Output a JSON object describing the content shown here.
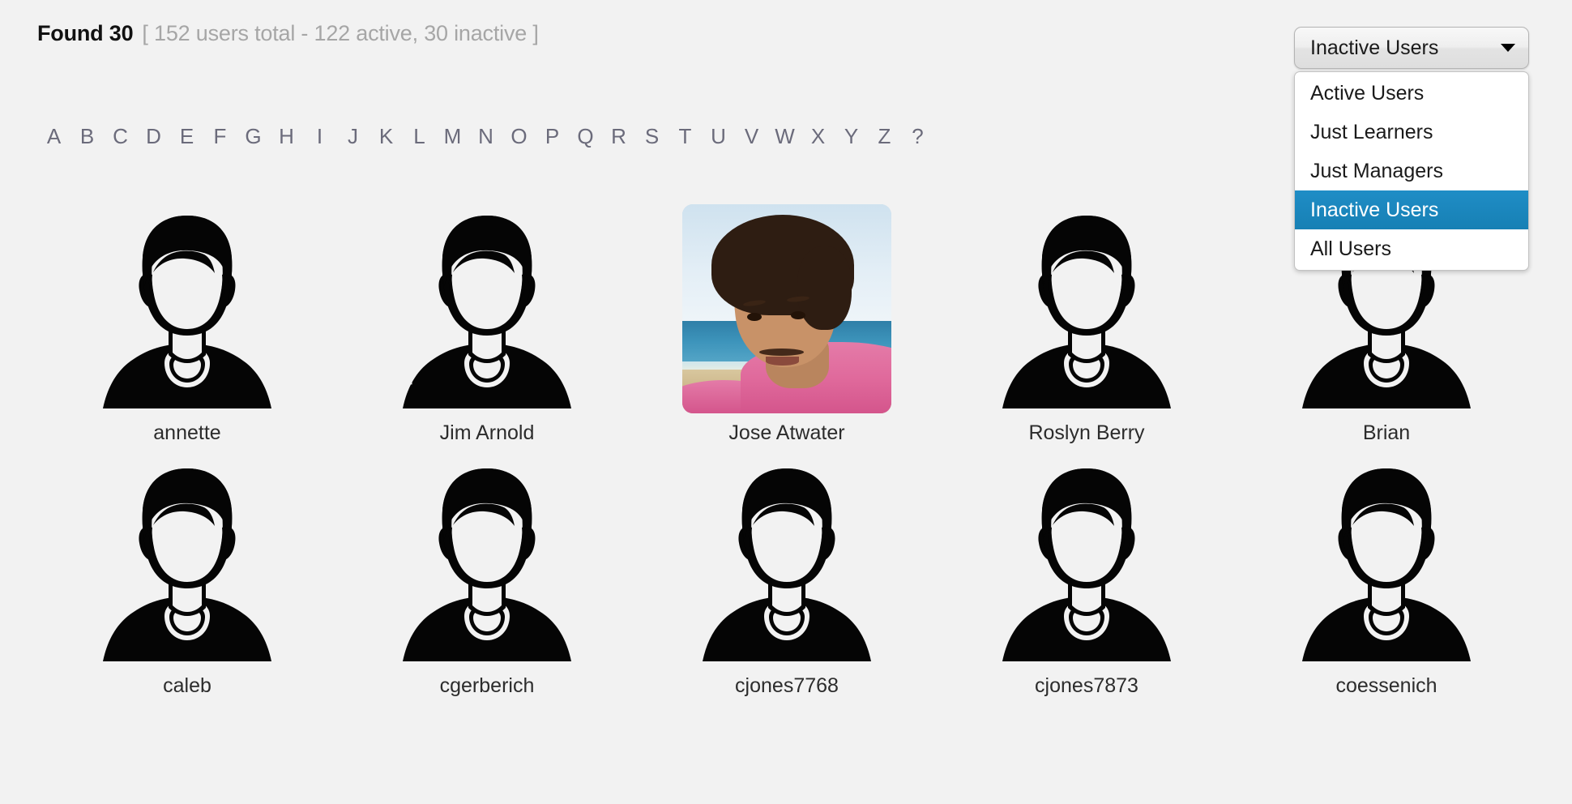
{
  "header": {
    "found_label": "Found 30",
    "found_detail": "[ 152 users total - 122 active, 30 inactive ]"
  },
  "alphabet_filter": {
    "letters": [
      "A",
      "B",
      "C",
      "D",
      "E",
      "F",
      "G",
      "H",
      "I",
      "J",
      "K",
      "L",
      "M",
      "N",
      "O",
      "P",
      "Q",
      "R",
      "S",
      "T",
      "U",
      "V",
      "W",
      "X",
      "Y",
      "Z",
      "?"
    ]
  },
  "filter_select": {
    "selected": "Inactive Users",
    "expanded": true,
    "arrow_icon": "chevron-down-icon",
    "options": [
      {
        "label": "Active Users",
        "selected": false
      },
      {
        "label": "Just Learners",
        "selected": false
      },
      {
        "label": "Just Managers",
        "selected": false
      },
      {
        "label": "Inactive Users",
        "selected": true
      },
      {
        "label": "All Users",
        "selected": false
      }
    ]
  },
  "users": [
    {
      "name": "annette",
      "avatar": "default-avatar-icon"
    },
    {
      "name": "Jim Arnold",
      "avatar": "default-avatar-icon"
    },
    {
      "name": "Jose Atwater",
      "avatar": "user-photo"
    },
    {
      "name": "Roslyn Berry",
      "avatar": "default-avatar-icon"
    },
    {
      "name": "Brian",
      "avatar": "default-avatar-icon"
    },
    {
      "name": "caleb",
      "avatar": "default-avatar-icon"
    },
    {
      "name": "cgerberich",
      "avatar": "default-avatar-icon"
    },
    {
      "name": "cjones7768",
      "avatar": "default-avatar-icon"
    },
    {
      "name": "cjones7873",
      "avatar": "default-avatar-icon"
    },
    {
      "name": "coessenich",
      "avatar": "default-avatar-icon"
    }
  ],
  "colors": {
    "page_background": "#f2f2f2",
    "heading_text": "#111111",
    "muted_text": "#a6a6a6",
    "alphabet_text": "#6b6b7b",
    "name_text": "#2c2c2c",
    "selected_option": "#1780b4",
    "avatar_silhouette": "#050505"
  }
}
